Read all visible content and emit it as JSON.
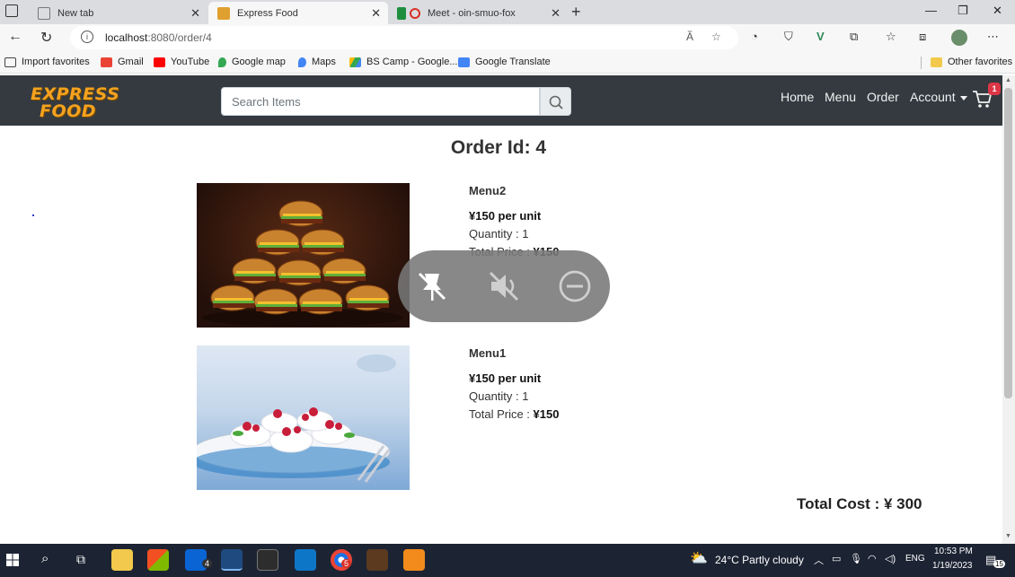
{
  "browser": {
    "tabs": [
      {
        "title": "New tab",
        "active": false
      },
      {
        "title": "Express Food",
        "active": true
      },
      {
        "title": "Meet - oin-smuo-fox",
        "active": false
      }
    ],
    "url_host": "localhost",
    "url_path": ":8080/order/4",
    "bookmarks": [
      {
        "label": "Import favorites",
        "icon": "import-icon"
      },
      {
        "label": "Gmail",
        "icon": "gmail-icon"
      },
      {
        "label": "YouTube",
        "icon": "youtube-icon"
      },
      {
        "label": "Google map",
        "icon": "google-map-icon"
      },
      {
        "label": "Maps",
        "icon": "maps-icon"
      },
      {
        "label": "BS Camp - Google...",
        "icon": "drive-icon"
      },
      {
        "label": "Google Translate",
        "icon": "translate-icon"
      }
    ],
    "other_favorites": "Other favorites"
  },
  "navbar": {
    "logo_line1": "EXPRESS",
    "logo_line2": "FOOD",
    "search_placeholder": "Search Items",
    "links": [
      "Home",
      "Menu",
      "Order",
      "Account"
    ],
    "cart_count": "1"
  },
  "order": {
    "title": "Order Id: 4",
    "items": [
      {
        "name": "Menu2",
        "price": "¥150 per unit",
        "quantity_label": "Quantity : 1",
        "total_label": "Total Price : ",
        "total_value": "¥150",
        "image": "burger-stack"
      },
      {
        "name": "Menu1",
        "price": "¥150 per unit",
        "quantity_label": "Quantity : 1",
        "total_label": "Total Price : ",
        "total_value": "¥150",
        "image": "meringue-dessert"
      }
    ],
    "total_cost": "Total Cost : ¥ 300"
  },
  "taskbar": {
    "weather": "24°C  Partly cloudy",
    "lang": "ENG",
    "time": "10:53 PM",
    "date": "1/19/2023",
    "mail_badge": "4",
    "chrome_badge": "5",
    "notif_count": "15"
  },
  "colors": {
    "navbar": "#343a40",
    "logo": "#f4a21f",
    "badge": "#dc3545",
    "taskbar": "#1c2433"
  }
}
